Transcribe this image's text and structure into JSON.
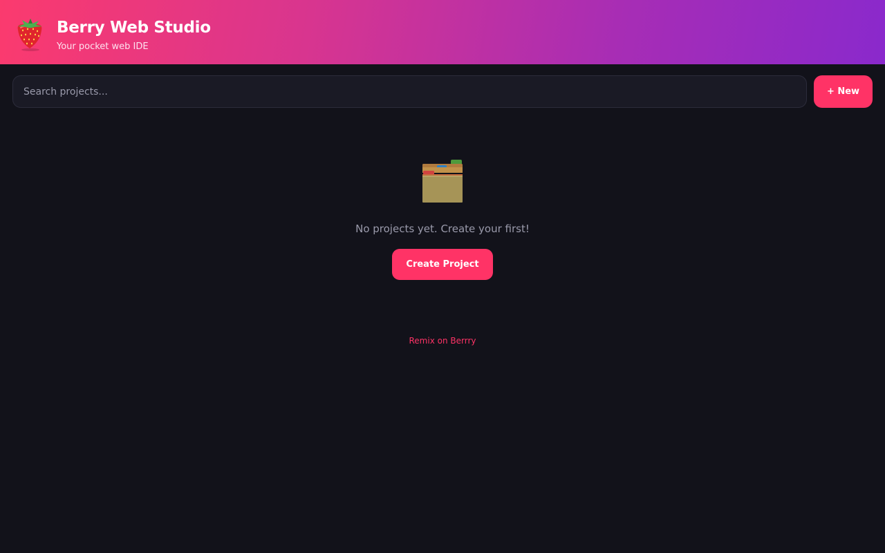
{
  "app": {
    "title": "Berry Web Studio",
    "subtitle": "Your pocket web IDE",
    "logo_icon": "strawberry-icon"
  },
  "toolbar": {
    "search_placeholder": "Search projects...",
    "search_value": "",
    "new_label": "+ New"
  },
  "empty_state": {
    "icon": "card-index-dividers-icon",
    "message": "No projects yet. Create your first!",
    "create_label": "Create Project"
  },
  "footer": {
    "remix_link": "Remix on Berrry"
  },
  "colors": {
    "accent": "#ff3366",
    "background": "#12121a",
    "header_gradient_start": "#fb3a6e",
    "header_gradient_end": "#8a29cc",
    "muted_text": "#9a9aab"
  }
}
